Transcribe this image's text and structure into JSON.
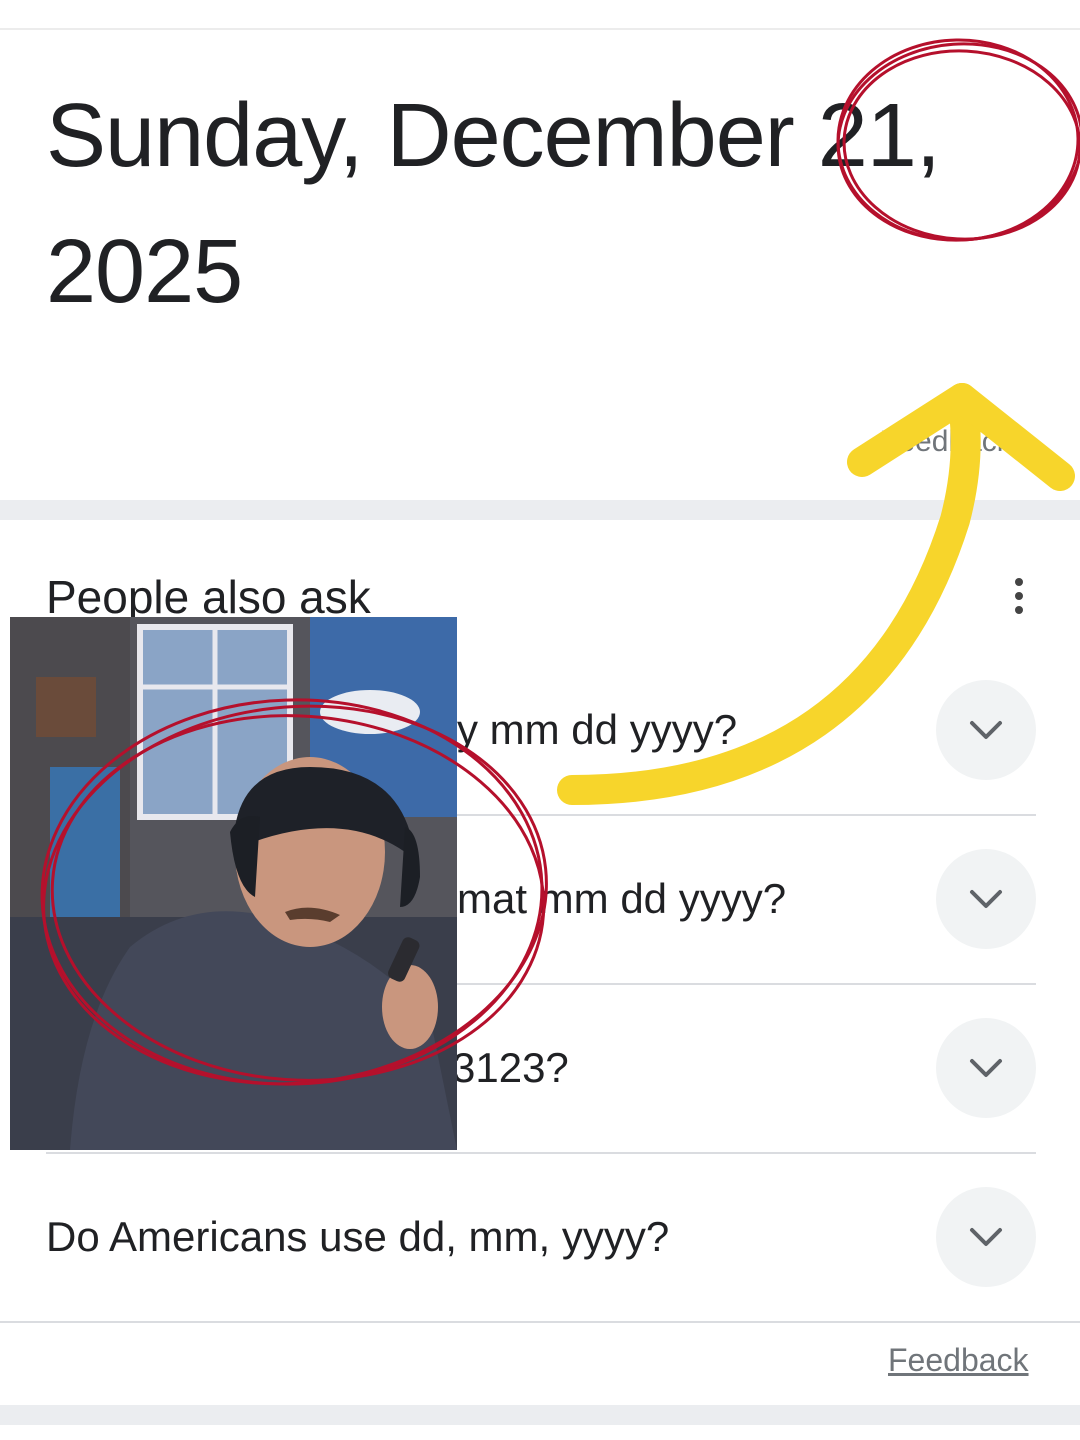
{
  "answer": {
    "date_line1": "Sunday, December 21,",
    "date_line2": "2025",
    "feedback_label": "Feedback"
  },
  "people_also_ask": {
    "title": "People also ask",
    "menu_icon": "more-vert-icon",
    "questions": [
      {
        "text": "y mm dd yyyy?"
      },
      {
        "text": "mat mm dd yyyy?"
      },
      {
        "text": "3123?"
      },
      {
        "text": "Do Americans use dd, mm, yyyy?"
      }
    ],
    "expand_icon": "chevron-down-icon"
  },
  "footer": {
    "feedback_label": "Feedback"
  },
  "annotations": {
    "circle_color": "#b5102c",
    "arrow_color": "#f7d52b"
  }
}
